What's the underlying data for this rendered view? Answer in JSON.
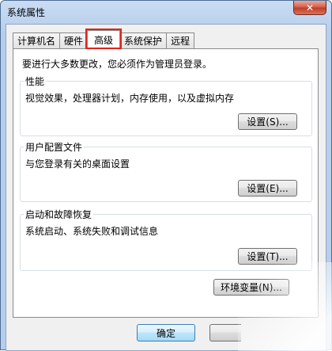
{
  "window": {
    "title": "系统属性",
    "close_label": "✕"
  },
  "tabs": [
    {
      "label": "计算机名",
      "active": false
    },
    {
      "label": "硬件",
      "active": false
    },
    {
      "label": "高级",
      "active": true
    },
    {
      "label": "系统保护",
      "active": false
    },
    {
      "label": "远程",
      "active": false
    }
  ],
  "intro_text": "要进行大多数更改，您必须作为管理员登录。",
  "groups": {
    "performance": {
      "label": "性能",
      "description": "视觉效果，处理器计划，内存使用，以及虚拟内存",
      "button": "设置(S)..."
    },
    "user_profiles": {
      "label": "用户配置文件",
      "description": "与您登录有关的桌面设置",
      "button": "设置(E)..."
    },
    "startup_recovery": {
      "label": "启动和故障恢复",
      "description": "系统启动、系统失败和调试信息",
      "button": "设置(T)..."
    }
  },
  "env_button": "环境变量(N)...",
  "ok_button": "确定",
  "colors": {
    "highlight": "#e2231a",
    "close_button": "#c13a22"
  },
  "icons": {
    "close": "close-icon"
  }
}
